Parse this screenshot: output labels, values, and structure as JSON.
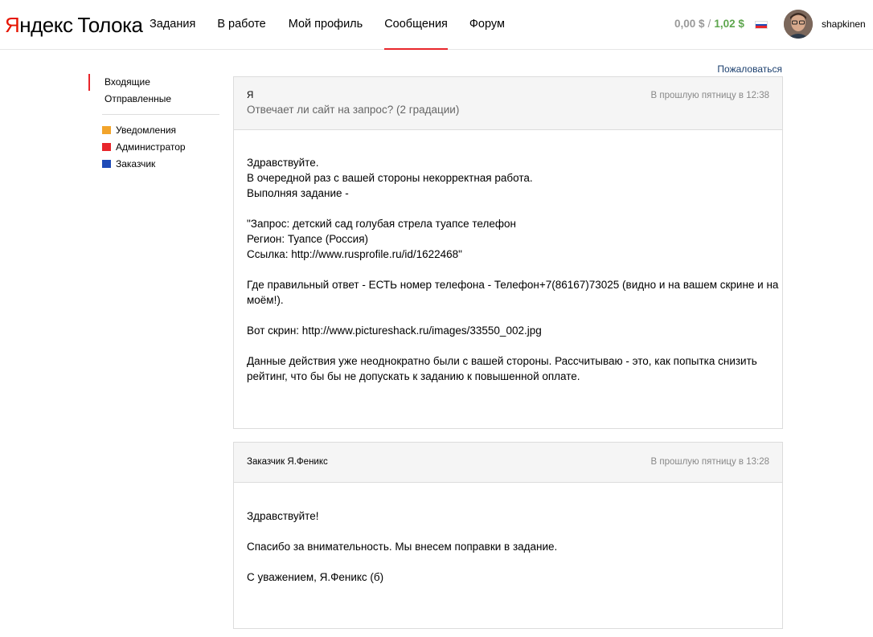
{
  "header": {
    "logo_brand_first": "Я",
    "logo_brand_rest": "ндекс",
    "logo_product": "Толока",
    "nav": [
      "Задания",
      "В работе",
      "Мой профиль",
      "Сообщения",
      "Форум"
    ],
    "active_nav": "Сообщения",
    "balance_available": "0,00 $",
    "balance_separator": "/",
    "balance_total": "1,02 $",
    "language_flag": "russia-flag-icon",
    "username": "shapkinen"
  },
  "sidebar": {
    "folders": [
      "Входящие",
      "Отправленные"
    ],
    "active_folder": "Входящие",
    "categories": [
      {
        "label": "Уведомления",
        "color": "#f2a42b"
      },
      {
        "label": "Администратор",
        "color": "#e8262b"
      },
      {
        "label": "Заказчик",
        "color": "#1f4bb8"
      }
    ]
  },
  "report_link": "Пожаловаться",
  "messages": [
    {
      "from": "Я",
      "subject": "Отвечает ли сайт на запрос? (2 градации)",
      "time": "В прошлую пятницу в 12:38",
      "body": [
        "Здравствуйте.",
        "В очередной раз с вашей стороны некорректная работа.",
        "Выполняя задание -",
        "",
        "\"Запрос: детский сад голубая стрела туапсе телефон",
        "Регион: Туапсе (Россия)",
        "Ссылка: http://www.rusprofile.ru/id/1622468\"",
        "",
        "Где правильный ответ - ЕСТЬ номер телефона - Телефон+7(86167)73025 (видно и на вашем скрине и на",
        "моём!).",
        "",
        "Вот скрин: http://www.pictureshack.ru/images/33550_002.jpg",
        "",
        "Данные действия уже неоднократно были с вашей стороны. Рассчитываю - это, как попытка снизить",
        "рейтинг, что бы бы не допускать к заданию к повышенной оплате."
      ]
    },
    {
      "from": "Заказчик Я.Феникс",
      "subject": "",
      "time": "В прошлую пятницу в 13:28",
      "body": [
        "Здравствуйте!",
        "",
        "Спасибо за внимательность. Мы внесем поправки в задание.",
        "",
        "С уважением, Я.Феникс (б)"
      ]
    }
  ]
}
